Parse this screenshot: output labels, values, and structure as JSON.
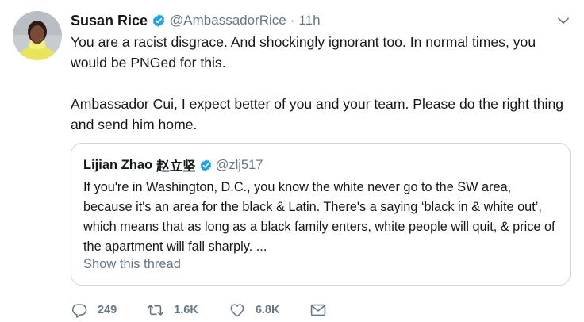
{
  "tweet": {
    "author_name": "Susan Rice",
    "author_handle": "@AmbassadorRice",
    "separator": "·",
    "time": "11h",
    "paragraphs": [
      "You are a racist disgrace. And shockingly ignorant too. In normal times, you would be PNGed for this.",
      "Ambassador Cui, I expect better of you and your team. Please do the right thing and send him home."
    ]
  },
  "quoted": {
    "author_name": "Lijian Zhao",
    "author_name_cjk": "赵立坚",
    "author_handle": "@zlj517",
    "text": "If you're in Washington, D.C., you know the white never go to the SW area, because it's an area for the black & Latin. There's a saying ‘black in & white out’, which means that as long as a black family enters, white people will quit, & price of the apartment will fall sharply. ...",
    "show_thread": "Show this thread"
  },
  "actions": {
    "replies": "249",
    "retweets": "1.6K",
    "likes": "6.8K"
  },
  "icons": {
    "verified": "verified-badge-icon",
    "caret": "chevron-down-icon",
    "reply": "reply-icon",
    "retweet": "retweet-icon",
    "like": "heart-icon",
    "dm": "envelope-icon"
  },
  "colors": {
    "verified_blue": "#1da1f2",
    "secondary_text": "#657786",
    "border": "#ccd6dd"
  }
}
